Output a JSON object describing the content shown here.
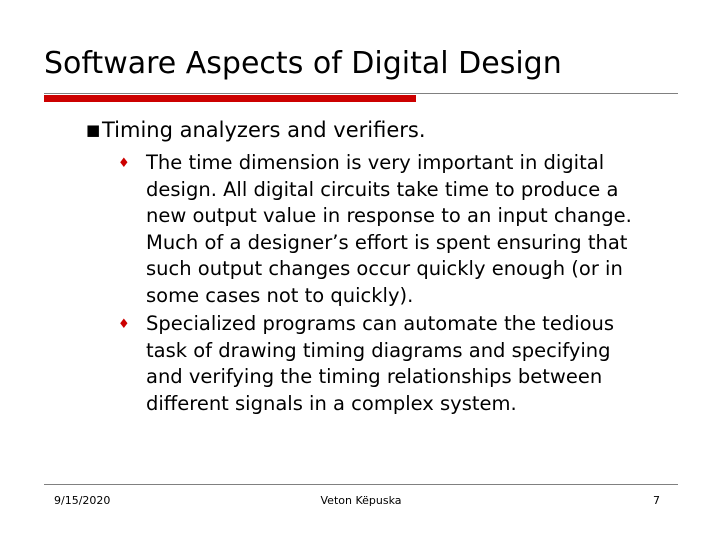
{
  "slide": {
    "title": "Software Aspects of Digital Design",
    "accent_color": "#cc0000",
    "heading": {
      "bullet": "■",
      "text": "Timing analyzers and verifiers."
    },
    "bullets": [
      {
        "marker": "♦",
        "text": "The time dimension is very important in digital design. All digital circuits take time to produce a new output value in response to an input change. Much of a designer’s effort is spent ensuring that such output changes occur quickly enough (or in some cases not to quickly)."
      },
      {
        "marker": "♦",
        "text": "Specialized programs can automate the tedious task of drawing timing diagrams and specifying and verifying the timing relationships between different signals in a complex system."
      }
    ],
    "footer": {
      "date": "9/15/2020",
      "center": "Veton Këpuska",
      "page": "7"
    }
  }
}
